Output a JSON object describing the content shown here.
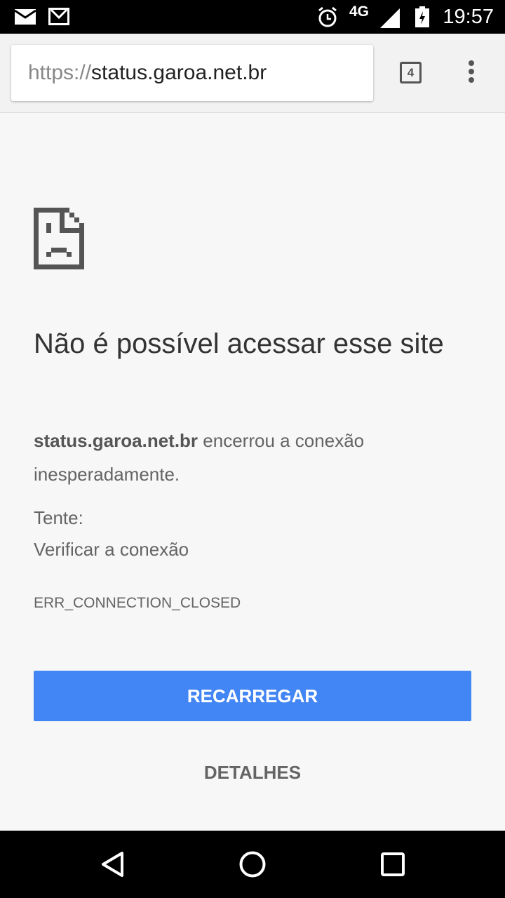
{
  "status_bar": {
    "time": "19:57",
    "network": "4G"
  },
  "toolbar": {
    "url_scheme": "https://",
    "url_host": "status.garoa.net.br",
    "tab_count": "4"
  },
  "error": {
    "title": "Não é possível acessar esse site",
    "host": "status.garoa.net.br",
    "message": " encerrou a conexão inesperadamente.",
    "try_label": "Tente:",
    "suggestion": "Verificar a conexão",
    "code": "ERR_CONNECTION_CLOSED",
    "reload_label": "RECARREGAR",
    "details_label": "DETALHES"
  },
  "colors": {
    "button": "#4285f4"
  }
}
